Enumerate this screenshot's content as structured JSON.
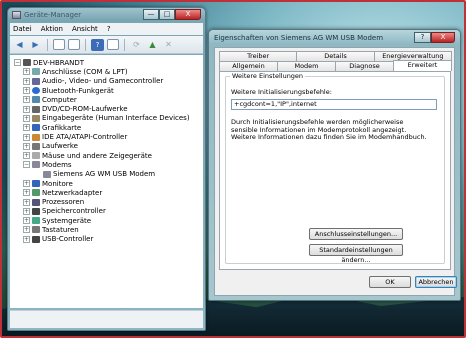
{
  "device_manager": {
    "title": "Geräte-Manager",
    "menu": [
      "Datei",
      "Aktion",
      "Ansicht",
      "?"
    ],
    "root": "DEV-HBRANDT",
    "categories": [
      {
        "label": "Anschlüsse (COM & LPT)",
        "icon": "port-icon"
      },
      {
        "label": "Audio-, Video- und Gamecontroller",
        "icon": "audio-icon"
      },
      {
        "label": "Bluetooth-Funkgerät",
        "icon": "bluetooth-icon"
      },
      {
        "label": "Computer",
        "icon": "computer-icon"
      },
      {
        "label": "DVD/CD-ROM-Laufwerke",
        "icon": "dvd-drive-icon"
      },
      {
        "label": "Eingabegeräte (Human Interface Devices)",
        "icon": "hid-icon"
      },
      {
        "label": "Grafikkarte",
        "icon": "display-adapter-icon"
      },
      {
        "label": "IDE ATA/ATAPI-Controller",
        "icon": "ide-controller-icon"
      },
      {
        "label": "Laufwerke",
        "icon": "disk-drive-icon"
      },
      {
        "label": "Mäuse und andere Zeigegeräte",
        "icon": "mouse-icon"
      },
      {
        "label": "Modems",
        "icon": "modem-icon",
        "expanded": true
      },
      {
        "label": "Monitore",
        "icon": "monitor-icon"
      },
      {
        "label": "Netzwerkadapter",
        "icon": "network-adapter-icon"
      },
      {
        "label": "Prozessoren",
        "icon": "processor-icon"
      },
      {
        "label": "Speichercontroller",
        "icon": "storage-controller-icon"
      },
      {
        "label": "Systemgeräte",
        "icon": "system-device-icon"
      },
      {
        "label": "Tastaturen",
        "icon": "keyboard-icon"
      },
      {
        "label": "USB-Controller",
        "icon": "usb-icon"
      }
    ],
    "modem_child": "Siemens AG WM USB Modem"
  },
  "dialog": {
    "title": "Eigenschaften von Siemens AG WM USB Modem",
    "tabs_row1": [
      "Treiber",
      "Details",
      "Energieverwaltung"
    ],
    "tabs_row2": [
      "Allgemein",
      "Modem",
      "Diagnose",
      "Erweitert"
    ],
    "active_tab": "Erweitert",
    "group_title": "Weitere Einstellungen",
    "init_label": "Weitere Initialisierungsbefehle:",
    "init_value": "+cgdcont=1,\"IP\",internet",
    "description": "Durch Initialisierungsbefehle werden möglicherweise sensible Informationen im Modemprotokoll angezeigt. Weitere Informationen dazu finden Sie im Modemhandbuch.",
    "btn_port_settings": "Anschlusseinstellungen...",
    "btn_defaults": "Standardeinstellungen ändern...",
    "btn_ok": "OK",
    "btn_cancel": "Abbrechen"
  },
  "window_controls": {
    "minimize": "—",
    "maximize": "□",
    "close": "X",
    "help": "?"
  }
}
